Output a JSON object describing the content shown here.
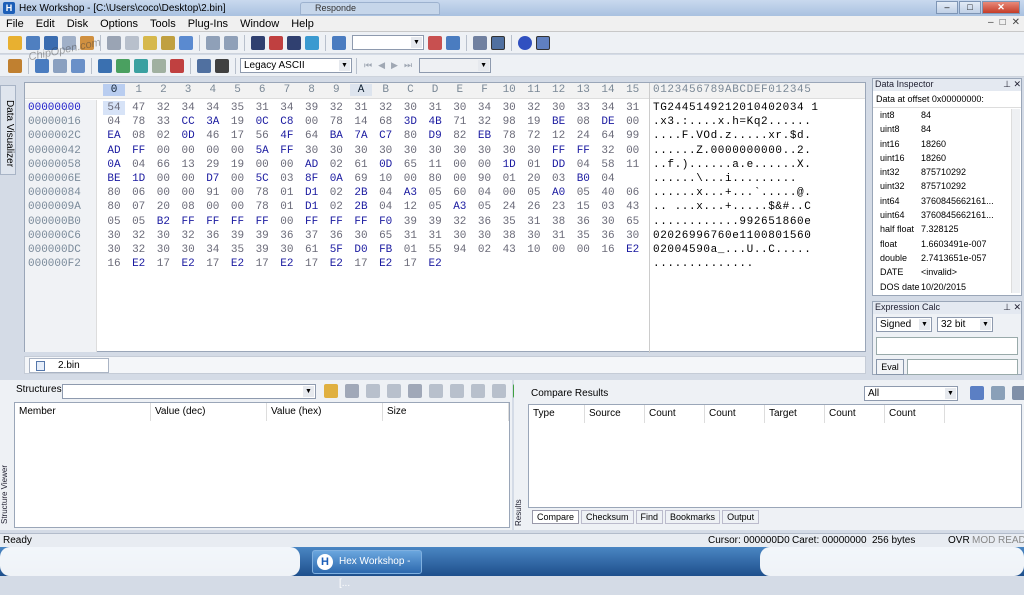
{
  "window": {
    "title": "Hex Workshop - [C:\\Users\\coco\\Desktop\\2.bin]",
    "ghost_tab": "Responde",
    "minimize": "–",
    "maximize": "□",
    "close": "✕"
  },
  "menu": [
    "File",
    "Edit",
    "Disk",
    "Options",
    "Tools",
    "Plug-Ins",
    "Window",
    "Help"
  ],
  "mdi_buttons": [
    "–",
    "□",
    "✕"
  ],
  "toolbar": {
    "encoding": "Legacy ASCII",
    "search_value": "",
    "goto_value": ""
  },
  "sidebar_tab": "Data Visualizer",
  "hex": {
    "columns": [
      "0",
      "1",
      "2",
      "3",
      "4",
      "5",
      "6",
      "7",
      "8",
      "9",
      "A",
      "B",
      "C",
      "D",
      "E",
      "F",
      "10",
      "11",
      "12",
      "13",
      "14",
      "15"
    ],
    "ascii_header": "0123456789ABCDEF012345",
    "rows": [
      {
        "offset": "00000000",
        "bytes": [
          "54",
          "47",
          "32",
          "34",
          "34",
          "35",
          "31",
          "34",
          "39",
          "32",
          "31",
          "32",
          "30",
          "31",
          "30",
          "34",
          "30",
          "32",
          "30",
          "33",
          "34",
          "31"
        ],
        "ascii": "TG2445149212010402034 1"
      },
      {
        "offset": "00000016",
        "bytes": [
          "04",
          "78",
          "33",
          "CC",
          "3A",
          "19",
          "0C",
          "C8",
          "00",
          "78",
          "14",
          "68",
          "3D",
          "4B",
          "71",
          "32",
          "98",
          "19",
          "BE",
          "08",
          "DE",
          "00"
        ],
        "ascii": ".x3.:....x.h=Kq2......"
      },
      {
        "offset": "0000002C",
        "bytes": [
          "EA",
          "08",
          "02",
          "0D",
          "46",
          "17",
          "56",
          "4F",
          "64",
          "BA",
          "7A",
          "C7",
          "80",
          "D9",
          "82",
          "EB",
          "78",
          "72",
          "12",
          "24",
          "64",
          "99"
        ],
        "ascii": "....F.VOd.z.....xr.$d."
      },
      {
        "offset": "00000042",
        "bytes": [
          "AD",
          "FF",
          "00",
          "00",
          "00",
          "00",
          "5A",
          "FF",
          "30",
          "30",
          "30",
          "30",
          "30",
          "30",
          "30",
          "30",
          "30",
          "30",
          "FF",
          "FF",
          "32",
          "00"
        ],
        "ascii": "......Z.0000000000..2."
      },
      {
        "offset": "00000058",
        "bytes": [
          "0A",
          "04",
          "66",
          "13",
          "29",
          "19",
          "00",
          "00",
          "AD",
          "02",
          "61",
          "0D",
          "65",
          "11",
          "00",
          "00",
          "1D",
          "01",
          "DD",
          "04",
          "58",
          "11"
        ],
        "ascii": "..f.)......a.e......X."
      },
      {
        "offset": "0000006E",
        "bytes": [
          "BE",
          "1D",
          "00",
          "00",
          "D7",
          "00",
          "5C",
          "03",
          "8F",
          "0A",
          "69",
          "10",
          "00",
          "80",
          "00",
          "90",
          "01",
          "20",
          "03",
          "B0",
          "04"
        ],
        "ascii": "......\\...i........."
      },
      {
        "offset": "00000084",
        "bytes": [
          "80",
          "06",
          "00",
          "00",
          "91",
          "00",
          "78",
          "01",
          "D1",
          "02",
          "2B",
          "04",
          "A3",
          "05",
          "60",
          "04",
          "00",
          "05",
          "A0",
          "05",
          "40",
          "06"
        ],
        "ascii": "......x...+...`.....@."
      },
      {
        "offset": "0000009A",
        "bytes": [
          "80",
          "07",
          "20",
          "08",
          "00",
          "00",
          "78",
          "01",
          "D1",
          "02",
          "2B",
          "04",
          "12",
          "05",
          "A3",
          "05",
          "24",
          "26",
          "23",
          "15",
          "03",
          "43"
        ],
        "ascii": ".. ...x...+.....$&#..C"
      },
      {
        "offset": "000000B0",
        "bytes": [
          "05",
          "05",
          "B2",
          "FF",
          "FF",
          "FF",
          "FF",
          "00",
          "FF",
          "FF",
          "FF",
          "F0",
          "39",
          "39",
          "32",
          "36",
          "35",
          "31",
          "38",
          "36",
          "30",
          "65"
        ],
        "ascii": "............992651860e"
      },
      {
        "offset": "000000C6",
        "bytes": [
          "30",
          "32",
          "30",
          "32",
          "36",
          "39",
          "39",
          "36",
          "37",
          "36",
          "30",
          "65",
          "31",
          "31",
          "30",
          "30",
          "38",
          "30",
          "31",
          "35",
          "36",
          "30"
        ],
        "ascii": "02026996760e1100801560"
      },
      {
        "offset": "000000DC",
        "bytes": [
          "30",
          "32",
          "30",
          "30",
          "34",
          "35",
          "39",
          "30",
          "61",
          "5F",
          "D0",
          "FB",
          "01",
          "55",
          "94",
          "02",
          "43",
          "10",
          "00",
          "00",
          "16",
          "E2"
        ],
        "ascii": "02004590a_...U..C....."
      },
      {
        "offset": "000000F2",
        "bytes": [
          "16",
          "E2",
          "17",
          "E2",
          "17",
          "E2",
          "17",
          "E2",
          "17",
          "E2",
          "17",
          "E2",
          "17",
          "E2"
        ],
        "ascii": ".............."
      }
    ]
  },
  "file_tab": "2.bin",
  "data_inspector": {
    "title": "Data Inspector",
    "subtitle": "Data at offset 0x00000000:",
    "rows": [
      {
        "k": "int8",
        "v": "84"
      },
      {
        "k": "uint8",
        "v": "84"
      },
      {
        "k": "int16",
        "v": "18260"
      },
      {
        "k": "uint16",
        "v": "18260"
      },
      {
        "k": "int32",
        "v": "875710292"
      },
      {
        "k": "uint32",
        "v": "875710292"
      },
      {
        "k": "int64",
        "v": "3760845662161..."
      },
      {
        "k": "uint64",
        "v": "3760845662161..."
      },
      {
        "k": "half float",
        "v": "7.328125"
      },
      {
        "k": "float",
        "v": "1.6603491e-007"
      },
      {
        "k": "double",
        "v": "2.7413651e-057"
      },
      {
        "k": "DATE",
        "v": "<invalid>"
      },
      {
        "k": "DOS date",
        "v": "10/20/2015"
      }
    ]
  },
  "expression_calc": {
    "title": "Expression Calc",
    "sign": "Signed",
    "width": "32 bit",
    "eval": "Eval"
  },
  "structures": {
    "title": "Structures",
    "side_tab": "Structure Viewer",
    "columns": [
      "Member",
      "Value (dec)",
      "Value (hex)",
      "Size"
    ]
  },
  "compare": {
    "title": "Compare Results",
    "filter": "All",
    "side_tab": "Results",
    "columns": [
      "Type",
      "Source",
      "Count",
      "Count",
      "Target",
      "Count",
      "Count"
    ],
    "tabs": [
      "Compare",
      "Checksum",
      "Find",
      "Bookmarks",
      "Output"
    ]
  },
  "status": {
    "left": "Ready",
    "cursor": "Cursor: 000000D0",
    "caret": "Caret: 00000000",
    "size": "256 bytes",
    "ovr": "OVR",
    "mod": "MOD",
    "read": "READ"
  },
  "taskbar": {
    "app": "Hex Workshop - [..."
  },
  "watermark": "ChipOpen.com",
  "colors": {
    "hex_byte": "#1a1aa0",
    "offset": "#7a8a9a",
    "selected_col": "#b9cdf0"
  }
}
